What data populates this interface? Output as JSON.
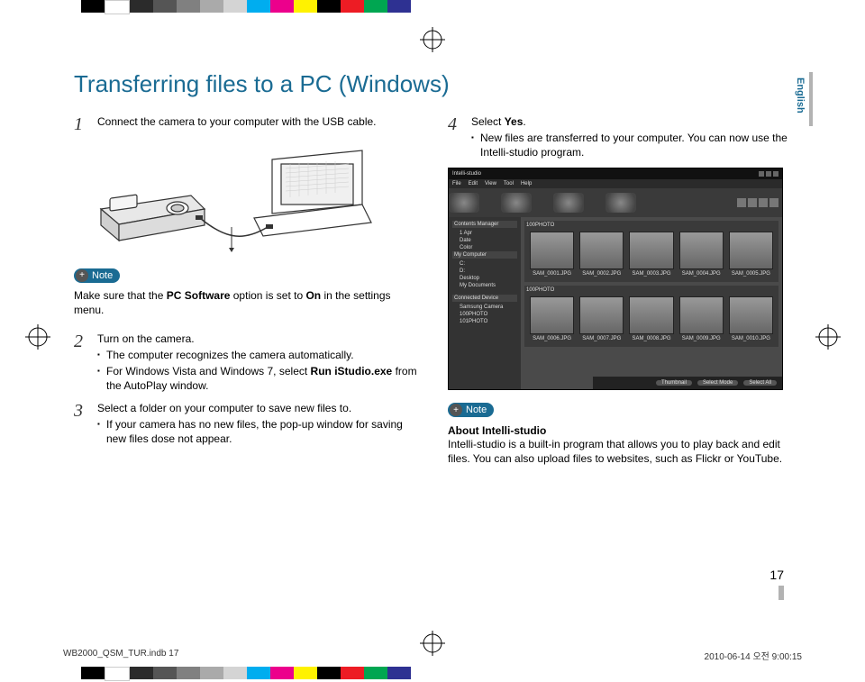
{
  "color_bar": [
    "#000000",
    "#FFFFFF",
    "#2B2B2B",
    "#555555",
    "#808080",
    "#AAAAAA",
    "#D4D4D4",
    "#00ADEF",
    "#EC008C",
    "#FFF200",
    "#000000",
    "#ED1C24",
    "#00A651",
    "#2E3192"
  ],
  "language_tab": "English",
  "title": "Transferring files to a PC (Windows)",
  "steps": {
    "s1": {
      "num": "1",
      "text": "Connect the camera to your computer with the USB cable."
    },
    "s2": {
      "num": "2",
      "text": "Turn on the camera.",
      "b1": "The computer recognizes the camera automatically.",
      "b2_pre": "For Windows Vista and Windows 7, select ",
      "b2_bold": "Run iStudio.exe",
      "b2_post": " from the AutoPlay window."
    },
    "s3": {
      "num": "3",
      "text": "Select a folder on your computer to save new files to.",
      "b1": "If your camera has no new files, the pop-up window for saving new files dose not appear."
    },
    "s4": {
      "num": "4",
      "text_pre": "Select ",
      "text_bold": "Yes",
      "text_post": ".",
      "b1": "New files are transferred to your computer. You can now use the Intelli-studio program."
    }
  },
  "note1": {
    "label": "Note",
    "text_pre": "Make sure that the ",
    "bold1": "PC Software",
    "mid": " option is set to ",
    "bold2": "On",
    "post": " in the settings menu."
  },
  "note2": {
    "label": "Note",
    "heading": "About Intelli-studio",
    "text": "Intelli-studio is a built-in program that allows you to play back and edit files. You can also upload files to websites, such as Flickr or YouTube."
  },
  "screenshot": {
    "app_title": "Intelli-studio",
    "menu": [
      "File",
      "Edit",
      "View",
      "Tool",
      "Help"
    ],
    "sidebar": {
      "contents_hdr": "Contents Manager",
      "items1": [
        "1 Apr",
        "Date",
        "Color"
      ],
      "mycomputer": "My Computer",
      "items2": [
        "C:",
        "D:",
        "Desktop",
        "My Documents"
      ],
      "connected_hdr": "Connected Device",
      "device": "Samsung Camera",
      "dev_items": [
        "100PHOTO",
        "101PHOTO"
      ]
    },
    "panel1": {
      "path": "100PHOTO",
      "thumbs": [
        "SAM_0001.JPG",
        "SAM_0002.JPG",
        "SAM_0003.JPG",
        "SAM_0004.JPG",
        "SAM_0005.JPG"
      ]
    },
    "panel2": {
      "path": "100PHOTO",
      "thumbs": [
        "SAM_0006.JPG",
        "SAM_0007.JPG",
        "SAM_0008.JPG",
        "SAM_0009.JPG",
        "SAM_0010.JPG"
      ]
    },
    "bottom": [
      "Thumbnail",
      "Select Mode",
      "Select All"
    ]
  },
  "page_number": "17",
  "footer": {
    "left": "WB2000_QSM_TUR.indb   17",
    "right": "2010-06-14   오전 9:00:15"
  }
}
